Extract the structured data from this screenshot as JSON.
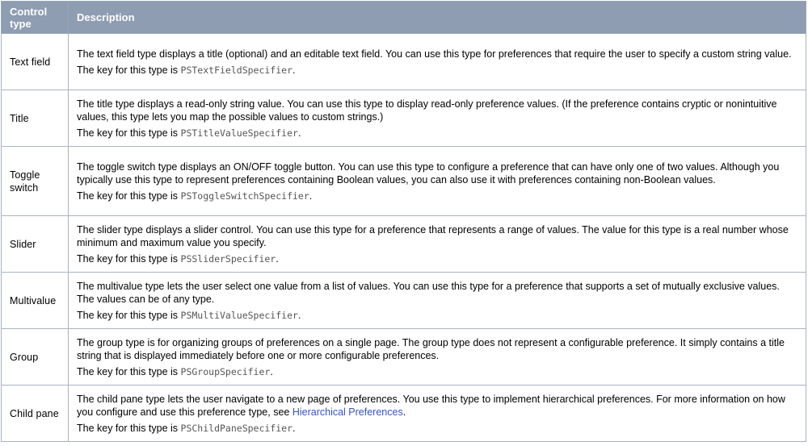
{
  "header": {
    "col_type": "Control type",
    "col_description": "Description"
  },
  "key_prefix": "The key for this type is ",
  "key_suffix": ".",
  "rows": [
    {
      "type": "Text field",
      "description": "The text field type displays a title (optional) and an editable text field. You can use this type for preferences that require the user to specify a custom string value.",
      "key": "PSTextFieldSpecifier"
    },
    {
      "type": "Title",
      "description": "The title type displays a read-only string value. You can use this type to display read-only preference values. (If the preference contains cryptic or nonintuitive values, this type lets you map the possible values to custom strings.)",
      "key": "PSTitleValueSpecifier"
    },
    {
      "type": "Toggle switch",
      "description": "The toggle switch type displays an ON/OFF toggle button. You can use this type to configure a preference that can have only one of two values. Although you typically use this type to represent preferences containing Boolean values, you can also use it with preferences containing non-Boolean values.",
      "key": "PSToggleSwitchSpecifier"
    },
    {
      "type": "Slider",
      "description": "The slider type displays a slider control. You can use this type for a preference that represents a range of values. The value for this type is a real number whose minimum and maximum value you specify.",
      "key": "PSSliderSpecifier"
    },
    {
      "type": "Multivalue",
      "description": "The multivalue type lets the user select one value from a list of values. You can use this type for a preference that supports a set of mutually exclusive values. The values can be of any type.",
      "key": "PSMultiValueSpecifier"
    },
    {
      "type": "Group",
      "description": "The group type is for organizing groups of preferences on a single page. The group type does not represent a configurable preference. It simply contains a title string that is displayed immediately before one or more configurable preferences.",
      "key": "PSGroupSpecifier"
    },
    {
      "type": "Child pane",
      "description": "The child pane type lets the user navigate to a new page of preferences. You use this type to implement hierarchical preferences. For more information on how you configure and use this preference type, see ",
      "link": "Hierarchical Preferences",
      "description_after_link": ".",
      "key": "PSChildPaneSpecifier"
    }
  ],
  "colors": {
    "header_bg": "#8e9db1",
    "header_text": "#ffffff",
    "border": "#a9b3c2",
    "link": "#3355bb",
    "code": "#555555"
  }
}
